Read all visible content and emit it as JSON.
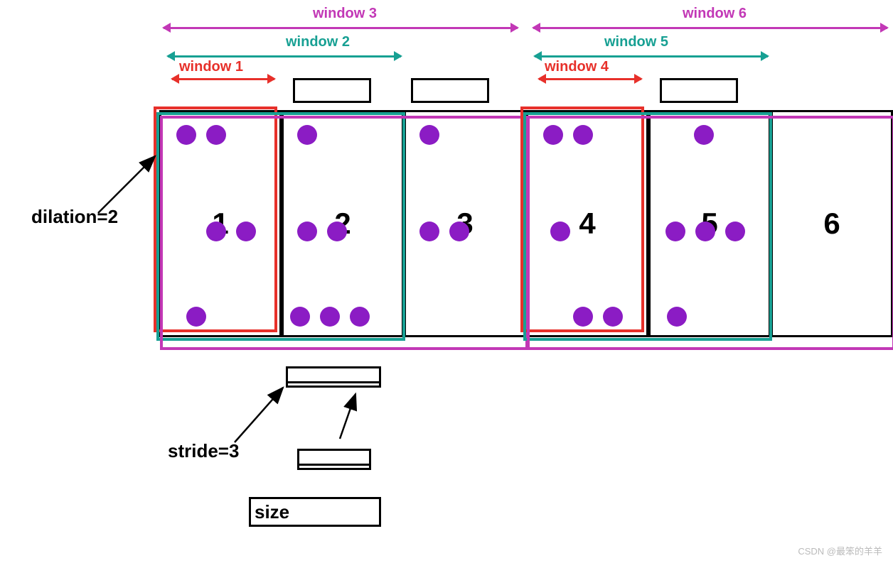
{
  "windows": {
    "w1": "window 1",
    "w2": "window 2",
    "w3": "window 3",
    "w4": "window 4",
    "w5": "window 5",
    "w6": "window 6"
  },
  "cells": [
    "1",
    "2",
    "3",
    "4",
    "5",
    "6"
  ],
  "annotations": {
    "dilation": "dilation=2",
    "stride": "stride=3",
    "size": "size"
  },
  "watermark": "CSDN @最笨的羊羊",
  "colors": {
    "red": "#e7302a",
    "teal": "#17a093",
    "magenta": "#c238b6",
    "purple": "#8b1cc4"
  },
  "diagram_info": {
    "type": "dilated-sliding-window",
    "window_count": 6,
    "dot_pattern_description": "purple dots illustrate kernel sample positions across windows"
  }
}
